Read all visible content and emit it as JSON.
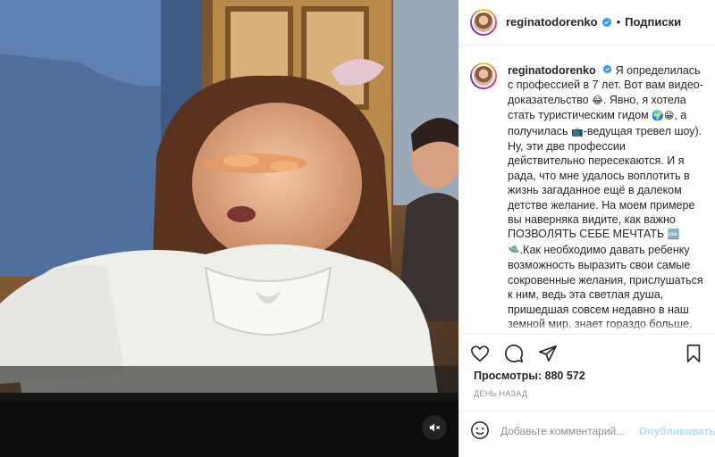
{
  "post": {
    "username": "reginatodorenko",
    "verified": true,
    "follow_label": "Подписки",
    "separator": "•"
  },
  "caption": {
    "username": "reginatodorenko",
    "part1": "Я определилась с профессией в 7 лет. Вот вам видео-доказательство ",
    "emoji1": "😂",
    "part2": ". Явно, я хотела стать туристическим гидом ",
    "emoji2": "🌍😁",
    "part3": ", а получилась ",
    "emoji3": "📺",
    "part4": "-ведущая тревел шоу). Ну, эти две профессии действительно пересекаются. И я рада, что мне удалось воплотить в жизнь загаданное ещё в далеком детстве желание. На моем примере вы наверняка видите, как важно ПОЗВОЛЯТЬ СЕБЕ МЕЧТАТЬ ",
    "emoji4": "🆒🛸",
    "part5": ".Как необходимо давать ребенку возможность выразить свои самые сокровенные желания, прислушаться к ним, ведь эта светлая душа, пришедшая совсем недавно в наш земной мир, знает гораздо больше, чем мы можем себе представить. Мы"
  },
  "actions": {
    "like_icon": "heart-icon",
    "comment_icon": "comment-icon",
    "share_icon": "paper-plane-icon",
    "save_icon": "bookmark-icon"
  },
  "stats": {
    "views_label": "Просмотры:",
    "views_value": "880 572",
    "date": "День назад"
  },
  "comment": {
    "placeholder": "Добавьте комментарий...",
    "publish_label": "Опубликовать"
  },
  "colors": {
    "verified_blue": "#3897f0",
    "publish_disabled": "#b3dbff",
    "muted_text": "#8e8e8e"
  }
}
